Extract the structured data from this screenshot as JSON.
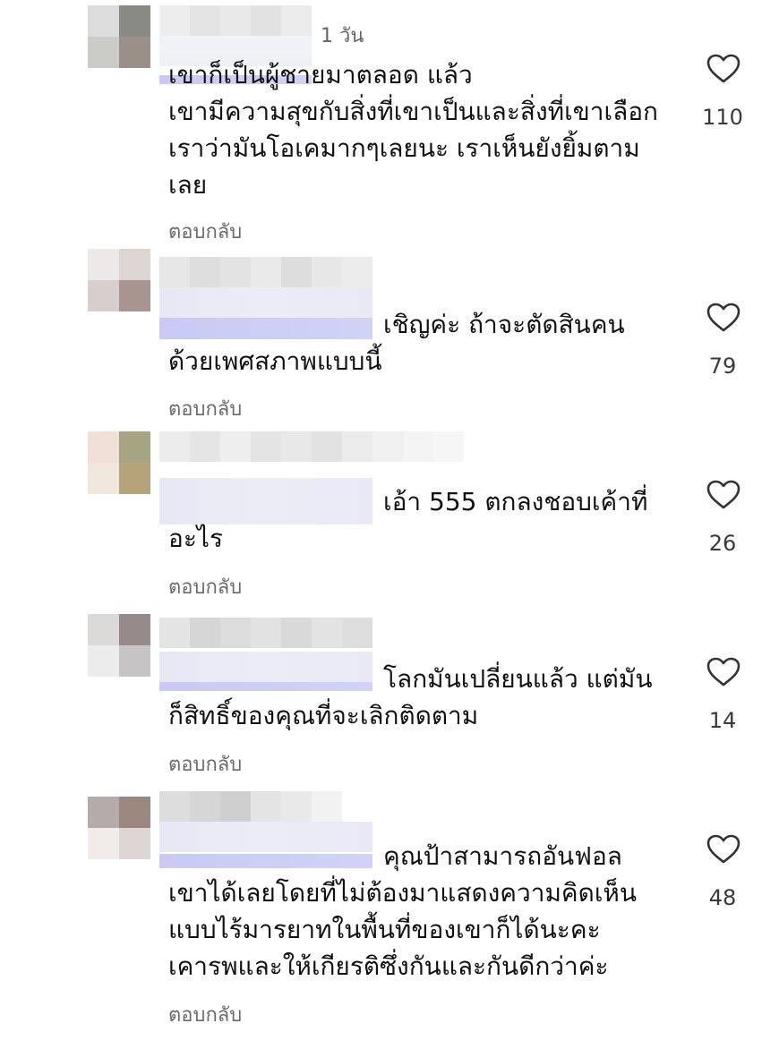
{
  "comments": [
    {
      "timestamp": "1 วัน",
      "text_first": "เขาก็เป็นผู้ชายมาตลอด แล้ว",
      "text_rest": "เขามีความสุขกับสิ่งที่เขาเป็นและสิ่งที่เขาเลือก เราว่ามันโอเคมากๆเลยนะ เราเห็นยังยิ้มตามเลย",
      "likes": "110",
      "reply": "ตอบกลับ"
    },
    {
      "text_first": "เชิญค่ะ ถ้าจะตัดสินคน",
      "text_rest": "ด้วยเพศสภาพแบบนี้",
      "likes": "79",
      "reply": "ตอบกลับ"
    },
    {
      "text_first": "เอ้า 555 ตกลงชอบเค้าที่",
      "text_rest": "อะไร",
      "likes": "26",
      "reply": "ตอบกลับ"
    },
    {
      "text_first": "โลกมันเปลี่ยนแล้ว แต่มัน",
      "text_rest": "ก็สิทธิ์ของคุณที่จะเลิกติดตาม",
      "likes": "14",
      "reply": "ตอบกลับ"
    },
    {
      "text_first": "คุณป้าสามารถอันฟอล",
      "text_rest": "เขาได้เลยโดยที่ไม่ต้องมาแสดงความคิดเห็นแบบไร้มารยาทในพื้นที่ของเขาก็ได้นะคะเคารพและให้เกียรติซึ่งกันและกันดีกว่าค่ะ",
      "likes": "48",
      "reply": "ตอบกลับ"
    }
  ],
  "icons": {
    "like": "heart-outline-icon",
    "avatar": "blurred-avatar"
  },
  "colors": {
    "text": "#111111",
    "secondary": "#6b6b6b",
    "redaction_tint": "#c9c9f4"
  }
}
